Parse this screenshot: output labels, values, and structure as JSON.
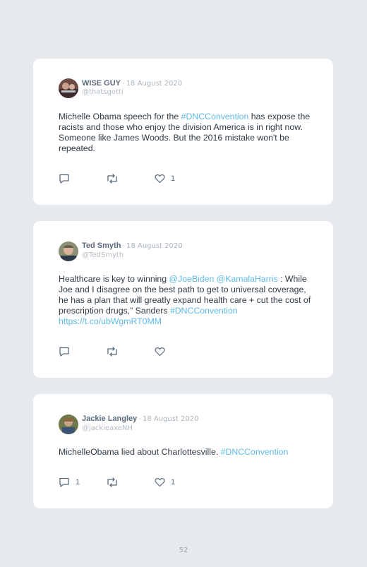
{
  "tweets": [
    {
      "name": "WISE GUY",
      "date": "18 August 2020",
      "handle": "@thatsgotti",
      "segments": [
        {
          "t": "Michelle Obama speech for the ",
          "link": false
        },
        {
          "t": "#DNCConvention",
          "link": true
        },
        {
          "t": " has expose the racists and those who enjoy the division America is in right now. Someone like James Woods. But the 2016 mistake won't be repeated.",
          "link": false
        }
      ],
      "reply_count": "",
      "like_count": "1"
    },
    {
      "name": "Ted Smyth",
      "date": "18 August 2020",
      "handle": "@TedSmyth",
      "segments": [
        {
          "t": "Healthcare is key to winning ",
          "link": false
        },
        {
          "t": "@JoeBiden",
          "link": true
        },
        {
          "t": " ",
          "link": false
        },
        {
          "t": "@KamalaHarris",
          "link": true
        },
        {
          "t": " : While Joe and I disagree on the best path to get to universal coverage, he has a plan that will greatly expand health care + cut the cost of prescription drugs,” Sanders ",
          "link": false
        },
        {
          "t": "#DNCConvention",
          "link": true
        },
        {
          "t": " ",
          "link": false
        },
        {
          "t": "https://t.co/ubWgmRT0MM",
          "link": true
        }
      ],
      "reply_count": "",
      "like_count": ""
    },
    {
      "name": "Jackie Langley",
      "date": "18 August 2020",
      "handle": "@jackieaxeNH",
      "segments": [
        {
          "t": "MichelleObama lied about Charlottesville. ",
          "link": false
        },
        {
          "t": "#DNCConvention",
          "link": true
        }
      ],
      "reply_count": "1",
      "like_count": "1"
    }
  ],
  "page_number": "52",
  "colors": {
    "link": "#5fb9ea",
    "background": "#e6e9ed",
    "card": "#ffffff"
  }
}
